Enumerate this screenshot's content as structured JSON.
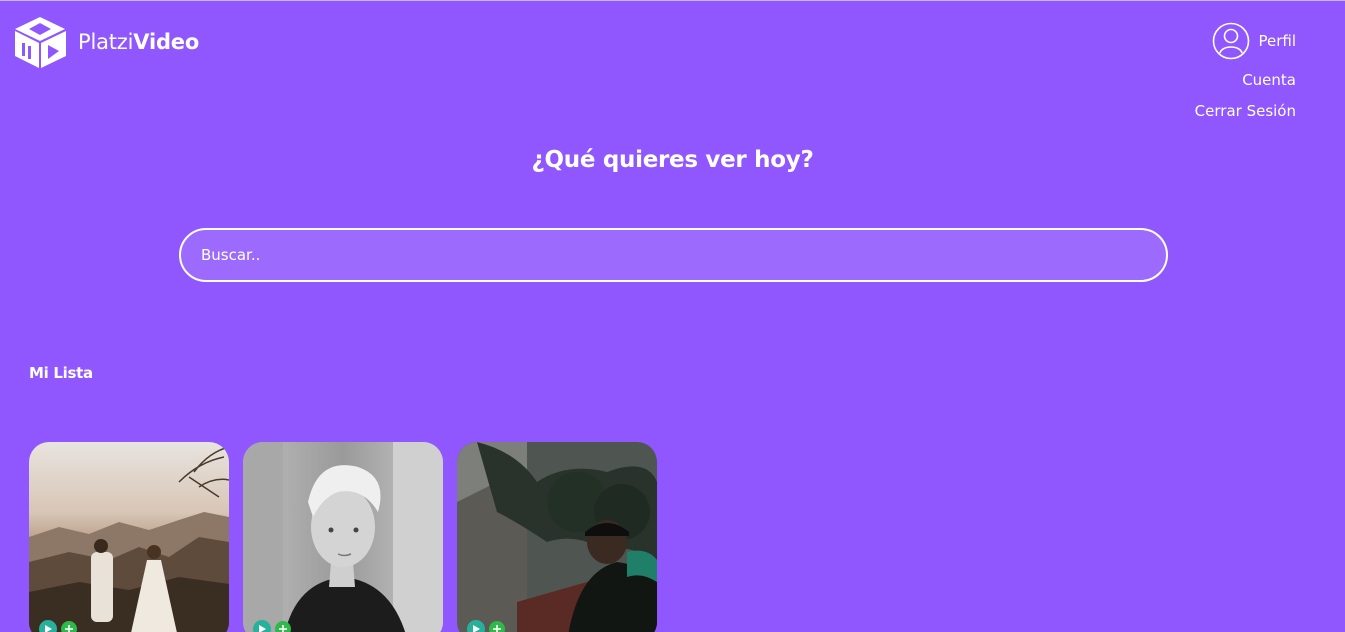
{
  "header": {
    "logo": {
      "text_light": "Platzi",
      "text_bold": "Video",
      "icon": "platzi-cube-logo-icon"
    },
    "profile": {
      "icon": "user-avatar-icon",
      "label": "Perfil",
      "menu": [
        {
          "label": "Cuenta"
        },
        {
          "label": "Cerrar Sesión"
        }
      ]
    }
  },
  "hero": {
    "title": "¿Qué quieres ver hoy?",
    "search": {
      "placeholder": "Buscar..",
      "value": ""
    }
  },
  "sections": [
    {
      "title": "Mi Lista",
      "items": [
        {
          "thumbnail": "couple-in-mountains-photo",
          "actions": [
            "play-icon",
            "plus-icon"
          ]
        },
        {
          "thumbnail": "blond-young-man-bw-photo",
          "actions": [
            "play-icon",
            "plus-icon"
          ]
        },
        {
          "thumbnail": "man-under-tree-photo",
          "actions": [
            "play-icon",
            "plus-icon"
          ]
        }
      ]
    }
  ],
  "colors": {
    "background": "#8f57fd",
    "text": "#ffffff",
    "play": "#27b09b",
    "add": "#2eb94a"
  }
}
